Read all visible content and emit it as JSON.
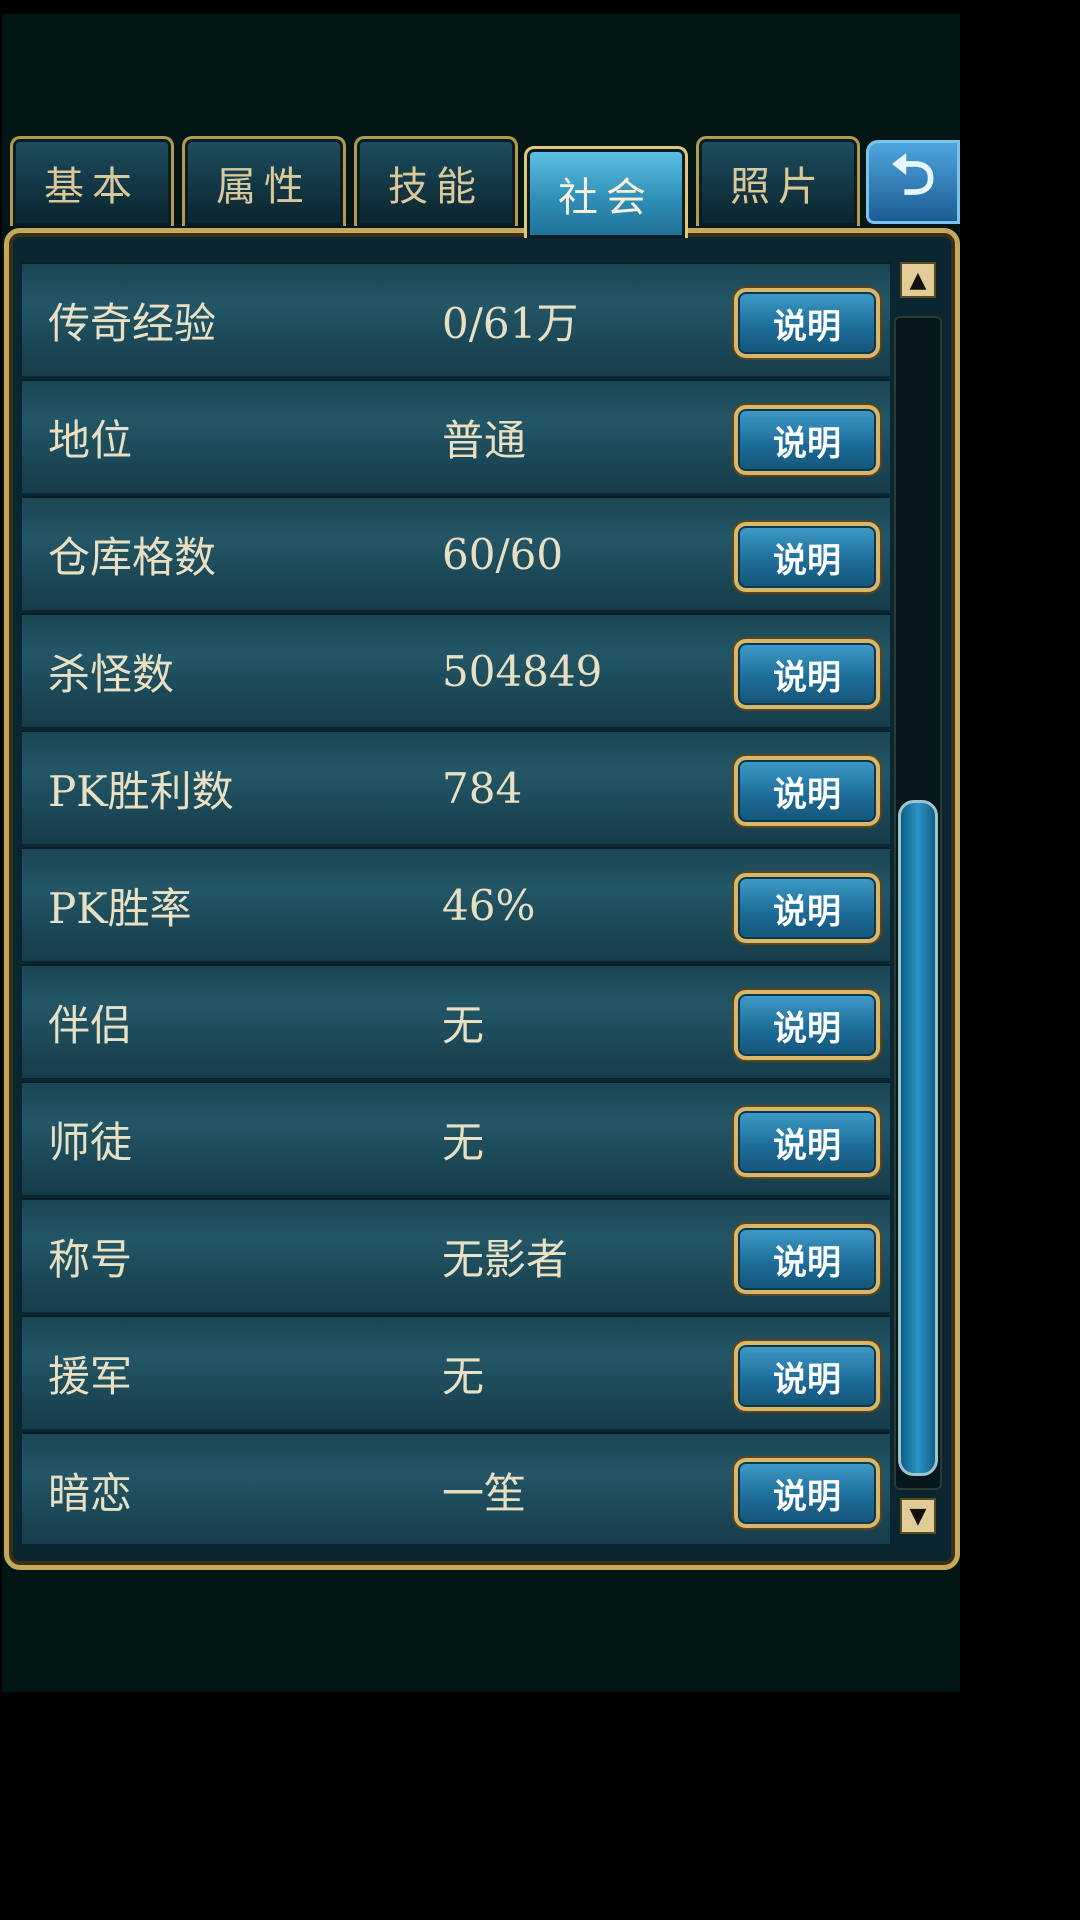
{
  "tabs": [
    {
      "label": "基本",
      "active": false
    },
    {
      "label": "属性",
      "active": false
    },
    {
      "label": "技能",
      "active": false
    },
    {
      "label": "社会",
      "active": true
    },
    {
      "label": "照片",
      "active": false
    }
  ],
  "back_icon": "back-arrow-icon",
  "button_label": "说明",
  "rows": [
    {
      "label": "传奇经验",
      "value": "0/61万"
    },
    {
      "label": "地位",
      "value": "普通"
    },
    {
      "label": "仓库格数",
      "value": "60/60"
    },
    {
      "label": "杀怪数",
      "value": "504849"
    },
    {
      "label": "PK胜利数",
      "value": "784"
    },
    {
      "label": "PK胜率",
      "value": "46%"
    },
    {
      "label": "伴侣",
      "value": "无"
    },
    {
      "label": "师徒",
      "value": "无"
    },
    {
      "label": "称号",
      "value": "无影者"
    },
    {
      "label": "援军",
      "value": "无"
    },
    {
      "label": "暗恋",
      "value": "一笙"
    }
  ],
  "colors": {
    "accent_gold": "#c6a85a",
    "active_tab": "#2f8fb8",
    "panel_bg": "#0a2630"
  }
}
